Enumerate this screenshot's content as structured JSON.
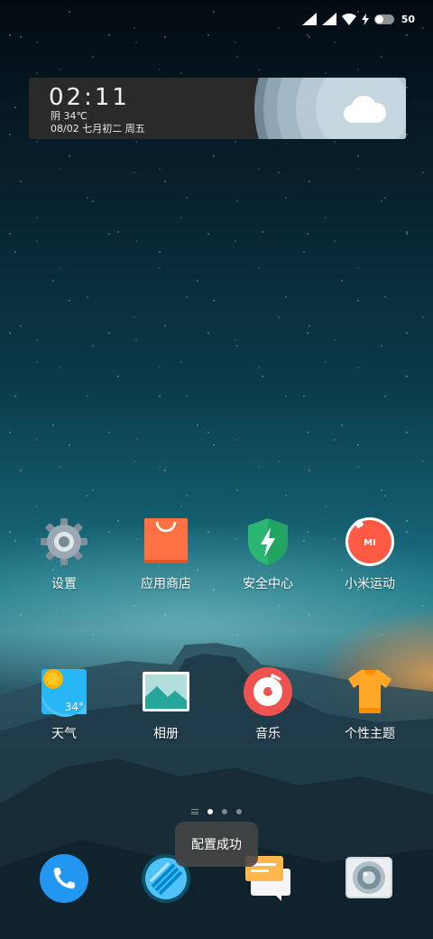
{
  "status_bar": {
    "battery_level": "50",
    "icons": [
      "signal-icon",
      "signal-icon",
      "wifi-icon",
      "charging-icon",
      "battery-toggle-icon"
    ]
  },
  "widget": {
    "time": "02:11",
    "weather": "阴 34℃",
    "date": "08/02 七月初二  周五",
    "icon": "cloud-icon"
  },
  "apps": [
    {
      "label": "设置",
      "icon": "gear-icon"
    },
    {
      "label": "应用商店",
      "icon": "shopping-bag-icon"
    },
    {
      "label": "安全中心",
      "icon": "shield-icon"
    },
    {
      "label": "小米运动",
      "icon": "mi-fit-icon"
    },
    {
      "label": "天气",
      "icon": "weather-icon",
      "badge": "34°"
    },
    {
      "label": "相册",
      "icon": "gallery-icon"
    },
    {
      "label": "音乐",
      "icon": "music-icon"
    },
    {
      "label": "个性主题",
      "icon": "tshirt-icon"
    }
  ],
  "page_indicator": {
    "pages": 3,
    "active": 0
  },
  "dock": [
    {
      "icon": "phone-icon"
    },
    {
      "icon": "browser-icon"
    },
    {
      "icon": "messages-icon"
    },
    {
      "icon": "camera-icon"
    }
  ],
  "toast": "配置成功",
  "colors": {
    "settings_gray": "#8a9aa6",
    "store_orange": "#ff7043",
    "security_green": "#2bb673",
    "mi_fit_red": "#ff5a44",
    "weather_blue": "#29b6f6",
    "gallery_teal": "#26a69a",
    "music_red": "#ef5350",
    "theme_orange": "#ffa726",
    "phone_blue": "#2196f3"
  }
}
